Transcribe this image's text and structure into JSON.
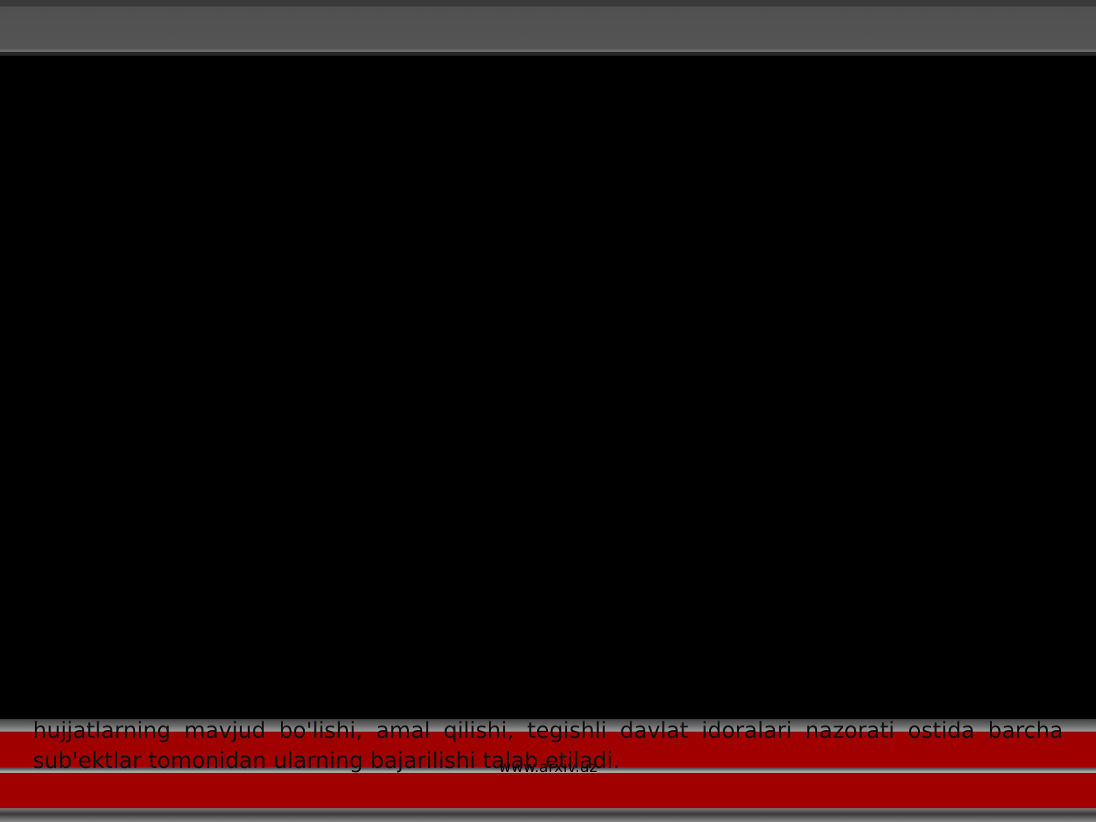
{
  "slide": {
    "body_text": "hujjatlarning mavjud bo'lishi, amal qilishi, tegishli davlat idoralari nazorati ostida barcha sub'ektlar tomonidan ularning bajarilishi talab etiladi.",
    "site_url": "www.arxiv.uz"
  },
  "colors": {
    "background": "#000000",
    "header_band": "#545454",
    "footer_band": "#a00000"
  }
}
